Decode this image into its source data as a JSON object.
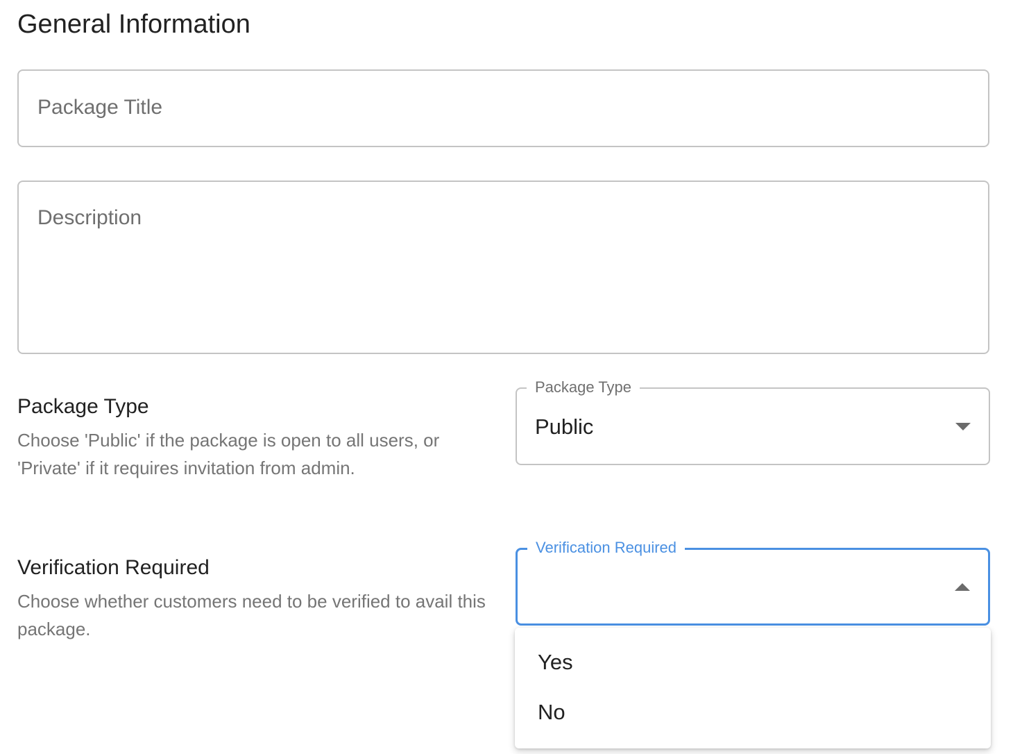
{
  "section": {
    "title": "General Information"
  },
  "fields": {
    "package_title": {
      "value": "",
      "placeholder": "Package Title"
    },
    "description": {
      "value": "",
      "placeholder": "Description"
    }
  },
  "package_type": {
    "label": "Package Type",
    "help": "Choose 'Public' if the package is open to all users, or 'Private' if it requires invitation from admin.",
    "select_label": "Package Type",
    "selected": "Public",
    "icon": "caret-down-icon"
  },
  "verification": {
    "label": "Verification Required",
    "help": "Choose whether customers need to be verified to avail this package.",
    "select_label": "Verification Required",
    "selected": "",
    "icon": "caret-up-icon",
    "state": "open",
    "accent_color": "#4a90e2",
    "options": [
      {
        "label": "Yes"
      },
      {
        "label": "No"
      }
    ]
  }
}
